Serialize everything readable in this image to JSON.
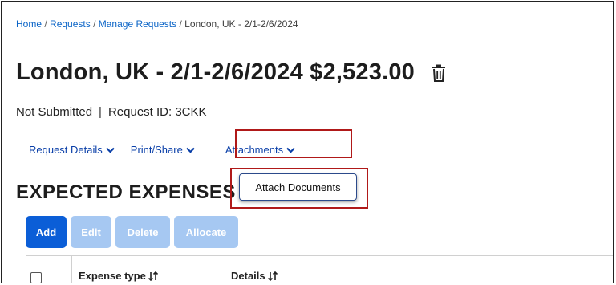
{
  "breadcrumb": {
    "items": [
      "Home",
      "Requests",
      "Manage Requests",
      "London, UK - 2/1-2/6/2024"
    ],
    "separator": "/"
  },
  "page": {
    "title": "London, UK - 2/1-2/6/2024 $2,523.00",
    "status": "Not Submitted",
    "status_divider": "|",
    "request_id": "Request ID: 3CKK",
    "delete_icon": "trash-icon"
  },
  "menu": {
    "items": [
      {
        "label": "Request Details",
        "icon": "chevron-down-icon"
      },
      {
        "label": "Print/Share",
        "icon": "chevron-down-icon"
      },
      {
        "label": "Attachments",
        "icon": "chevron-down-icon"
      }
    ]
  },
  "dropdown": {
    "items": [
      "Attach Documents"
    ]
  },
  "section": {
    "title": "EXPECTED EXPENSES"
  },
  "toolbar": {
    "add": "Add",
    "edit": "Edit",
    "delete": "Delete",
    "allocate": "Allocate"
  },
  "grid": {
    "columns": [
      "Expense type",
      "Details"
    ],
    "sort_icon": "sort-icon"
  },
  "colors": {
    "link": "#0a64c7",
    "menu_link": "#0a3fa8",
    "primary_button": "#0b5ed7",
    "disabled_button": "#a6c8f2",
    "highlight": "#b01919"
  }
}
